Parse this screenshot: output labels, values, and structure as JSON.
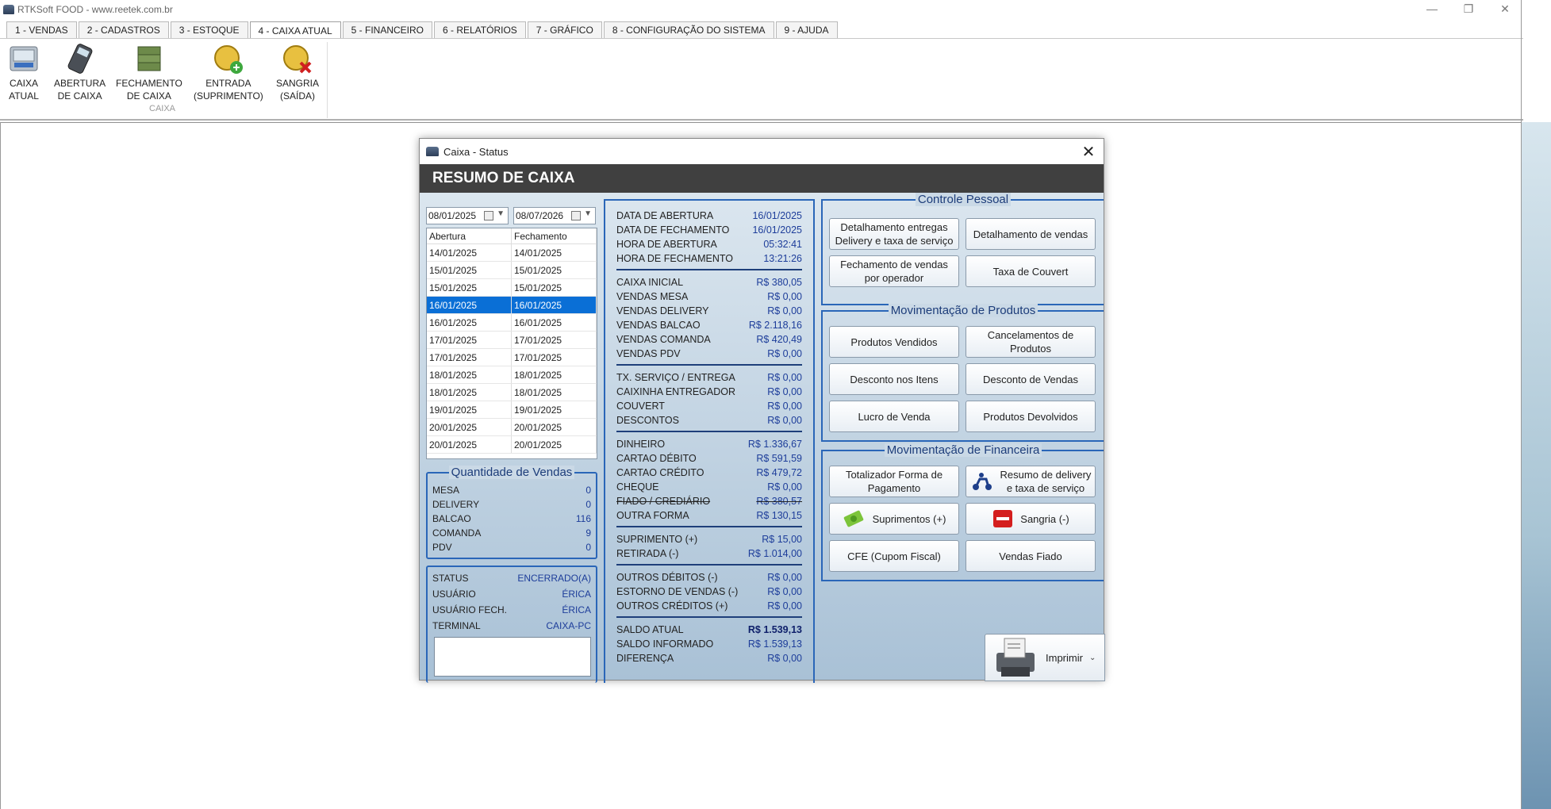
{
  "app": {
    "title": "RTKSoft FOOD - www.reetek.com.br"
  },
  "menu": {
    "tabs": [
      {
        "label": "1 - VENDAS"
      },
      {
        "label": "2 - CADASTROS"
      },
      {
        "label": "3 - ESTOQUE"
      },
      {
        "label": "4 - CAIXA ATUAL"
      },
      {
        "label": "5 - FINANCEIRO"
      },
      {
        "label": "6 - RELATÓRIOS"
      },
      {
        "label": "7 - GRÁFICO"
      },
      {
        "label": "8 - CONFIGURAÇÃO DO SISTEMA"
      },
      {
        "label": "9 - AJUDA"
      }
    ]
  },
  "ribbon": {
    "group_label": "CAIXA",
    "buttons": {
      "caixa_atual": {
        "line1": "CAIXA",
        "line2": "ATUAL"
      },
      "abertura": {
        "line1": "ABERTURA",
        "line2": "DE CAIXA"
      },
      "fechamento": {
        "line1": "FECHAMENTO",
        "line2": "DE CAIXA"
      },
      "entrada": {
        "line1": "ENTRADA",
        "line2": "(SUPRIMENTO)"
      },
      "sangria": {
        "line1": "SANGRIA",
        "line2": "(SAÍDA)"
      }
    }
  },
  "dialog": {
    "title": "Caixa - Status",
    "header": "RESUMO DE CAIXA",
    "date_from": "08/01/2025",
    "date_to": "08/07/2026",
    "table": {
      "col_open": "Abertura",
      "col_close": "Fechamento",
      "rows": [
        [
          "14/01/2025",
          "14/01/2025"
        ],
        [
          "15/01/2025",
          "15/01/2025"
        ],
        [
          "15/01/2025",
          "15/01/2025"
        ],
        [
          "16/01/2025",
          "16/01/2025"
        ],
        [
          "16/01/2025",
          "16/01/2025"
        ],
        [
          "17/01/2025",
          "17/01/2025"
        ],
        [
          "17/01/2025",
          "17/01/2025"
        ],
        [
          "18/01/2025",
          "18/01/2025"
        ],
        [
          "18/01/2025",
          "18/01/2025"
        ],
        [
          "19/01/2025",
          "19/01/2025"
        ],
        [
          "20/01/2025",
          "20/01/2025"
        ],
        [
          "20/01/2025",
          "20/01/2025"
        ]
      ]
    },
    "qtd": {
      "title": "Quantidade de Vendas",
      "items": [
        {
          "k": "MESA",
          "v": "0"
        },
        {
          "k": "DELIVERY",
          "v": "0"
        },
        {
          "k": "BALCAO",
          "v": "116"
        },
        {
          "k": "COMANDA",
          "v": "9"
        },
        {
          "k": "PDV",
          "v": "0"
        }
      ]
    },
    "status": {
      "items": [
        {
          "k": "STATUS",
          "v": "ENCERRADO(A)"
        },
        {
          "k": "USUÁRIO",
          "v": "ÉRICA"
        },
        {
          "k": "USUÁRIO FECH.",
          "v": "ÉRICA"
        },
        {
          "k": "TERMINAL",
          "v": "CAIXA-PC"
        }
      ]
    },
    "resumo": {
      "g1": [
        {
          "k": "DATA DE ABERTURA",
          "v": "16/01/2025"
        },
        {
          "k": "DATA DE FECHAMENTO",
          "v": "16/01/2025"
        },
        {
          "k": "HORA DE ABERTURA",
          "v": "05:32:41"
        },
        {
          "k": "HORA DE FECHAMENTO",
          "v": "13:21:26"
        }
      ],
      "g2": [
        {
          "k": "CAIXA INICIAL",
          "v": "R$ 380,05"
        },
        {
          "k": "VENDAS MESA",
          "v": "R$ 0,00"
        },
        {
          "k": "VENDAS DELIVERY",
          "v": "R$ 0,00"
        },
        {
          "k": "VENDAS BALCAO",
          "v": "R$ 2.118,16"
        },
        {
          "k": "VENDAS COMANDA",
          "v": "R$ 420,49"
        },
        {
          "k": "VENDAS PDV",
          "v": "R$ 0,00"
        }
      ],
      "g3": [
        {
          "k": "TX. SERVIÇO / ENTREGA",
          "v": "R$ 0,00"
        },
        {
          "k": "CAIXINHA ENTREGADOR",
          "v": "R$ 0,00"
        },
        {
          "k": "COUVERT",
          "v": "R$ 0,00"
        },
        {
          "k": "DESCONTOS",
          "v": "R$ 0,00"
        }
      ],
      "g4": [
        {
          "k": "DINHEIRO",
          "v": "R$ 1.336,67"
        },
        {
          "k": "CARTAO DÉBITO",
          "v": "R$ 591,59"
        },
        {
          "k": "CARTAO CRÉDITO",
          "v": "R$ 479,72"
        },
        {
          "k": "CHEQUE",
          "v": "R$ 0,00"
        },
        {
          "k": "FIADO / CREDIÁRIO",
          "v": "R$ 380,57"
        },
        {
          "k": "OUTRA FORMA",
          "v": "R$ 130,15"
        }
      ],
      "g5": [
        {
          "k": "SUPRIMENTO (+)",
          "v": "R$ 15,00"
        },
        {
          "k": "RETIRADA (-)",
          "v": "R$ 1.014,00"
        }
      ],
      "g6": [
        {
          "k": "OUTROS DÉBITOS   (-)",
          "v": "R$ 0,00"
        },
        {
          "k": "ESTORNO DE VENDAS (-)",
          "v": "R$ 0,00"
        },
        {
          "k": "OUTROS CRÉDITOS (+)",
          "v": "R$ 0,00"
        }
      ],
      "g7": [
        {
          "k": "SALDO ATUAL",
          "v": "R$ 1.539,13"
        },
        {
          "k": "SALDO INFORMADO",
          "v": "R$ 1.539,13"
        },
        {
          "k": "DIFERENÇA",
          "v": "R$ 0,00"
        }
      ]
    },
    "controle": {
      "title": "Controle Pessoal",
      "b1a": "Detalhamento entregas",
      "b1b": "Delivery e taxa de serviço",
      "b2": "Detalhamento de vendas",
      "b3a": "Fechamento de vendas",
      "b3b": "por operador",
      "b4": "Taxa de Couvert"
    },
    "produtos": {
      "title": "Movimentação de Produtos",
      "b1": "Produtos Vendidos",
      "b2a": "Cancelamentos de",
      "b2b": "Produtos",
      "b3": "Desconto nos Itens",
      "b4": "Desconto de Vendas",
      "b5": "Lucro de Venda",
      "b6": "Produtos Devolvidos"
    },
    "financeira": {
      "title": "Movimentação de Financeira",
      "b1a": "Totalizador Forma de",
      "b1b": "Pagamento",
      "b2a": "Resumo de delivery",
      "b2b": "e taxa de serviço",
      "b3": "Suprimentos (+)",
      "b4": "Sangria (-)",
      "b5": "CFE (Cupom Fiscal)",
      "b6": "Vendas Fiado"
    },
    "print_label": "Imprimir"
  },
  "colors": {
    "accent_blue": "#2a66b8",
    "value_blue": "#1d3d9a",
    "selected_row": "#0a6fd6",
    "header_bg": "#404040"
  },
  "icons": [
    "window-icon",
    "cash-register-icon",
    "card-machine-icon",
    "money-stack-icon",
    "coin-plus-icon",
    "coin-remove-icon",
    "calendar-icon",
    "delivery-scooter-icon",
    "money-plus-icon",
    "minus-sign-icon",
    "printer-icon",
    "close-icon"
  ]
}
